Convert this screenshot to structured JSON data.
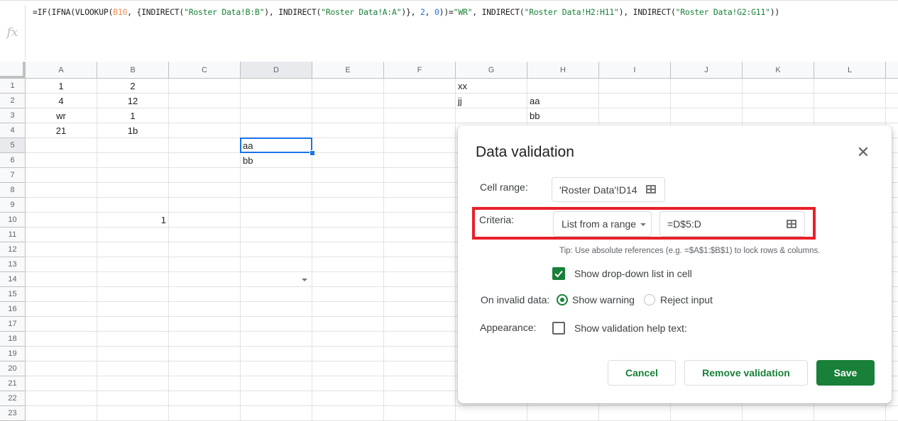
{
  "formula_bar": {
    "icon": "fx",
    "formula_parts": [
      {
        "t": "=IF(IFNA(VLOOKUP(",
        "k": "plain"
      },
      {
        "t": "B10",
        "k": "ref"
      },
      {
        "t": ", {INDIRECT(",
        "k": "plain"
      },
      {
        "t": "\"Roster Data!B:B\"",
        "k": "str"
      },
      {
        "t": "), INDIRECT(",
        "k": "plain"
      },
      {
        "t": "\"Roster Data!A:A\"",
        "k": "str"
      },
      {
        "t": ")}, ",
        "k": "plain"
      },
      {
        "t": "2",
        "k": "num"
      },
      {
        "t": ", ",
        "k": "plain"
      },
      {
        "t": "0",
        "k": "num"
      },
      {
        "t": "))=",
        "k": "plain"
      },
      {
        "t": "\"WR\"",
        "k": "str"
      },
      {
        "t": ", INDIRECT(",
        "k": "plain"
      },
      {
        "t": "\"Roster Data!H2:H11\"",
        "k": "str"
      },
      {
        "t": "), INDIRECT(",
        "k": "plain"
      },
      {
        "t": "\"Roster Data!G2:G11\"",
        "k": "str"
      },
      {
        "t": "))",
        "k": "plain"
      }
    ]
  },
  "sheet": {
    "columns": [
      "A",
      "B",
      "C",
      "D",
      "E",
      "F",
      "G",
      "H",
      "I",
      "J",
      "K",
      "L"
    ],
    "selected_column": "D",
    "rows": [
      "1",
      "2",
      "3",
      "4",
      "5",
      "6",
      "7",
      "8",
      "9",
      "10",
      "11",
      "12",
      "13",
      "14",
      "15",
      "16",
      "17",
      "18",
      "19",
      "20",
      "21",
      "22",
      "23"
    ],
    "selected_row": "5",
    "selected_cell": "D5",
    "dropdown_cell": "D14",
    "cells": [
      {
        "ref": "A1",
        "value": "1",
        "align": "c"
      },
      {
        "ref": "B1",
        "value": "2",
        "align": "c"
      },
      {
        "ref": "A2",
        "value": "4",
        "align": "c"
      },
      {
        "ref": "B2",
        "value": "12",
        "align": "c"
      },
      {
        "ref": "A3",
        "value": "wr",
        "align": "c"
      },
      {
        "ref": "B3",
        "value": "1",
        "align": "c"
      },
      {
        "ref": "A4",
        "value": "21",
        "align": "c"
      },
      {
        "ref": "B4",
        "value": "1b",
        "align": "c"
      },
      {
        "ref": "D5",
        "value": "aa",
        "align": "l"
      },
      {
        "ref": "D6",
        "value": "bb",
        "align": "l"
      },
      {
        "ref": "B10",
        "value": "1",
        "align": "r"
      },
      {
        "ref": "G1",
        "value": "xx",
        "align": "l"
      },
      {
        "ref": "G2",
        "value": "jj",
        "align": "l"
      },
      {
        "ref": "H2",
        "value": "aa",
        "align": "l"
      },
      {
        "ref": "H3",
        "value": "bb",
        "align": "l"
      }
    ]
  },
  "dialog": {
    "title": "Data validation",
    "close_icon": "close-icon",
    "cell_range_label": "Cell range:",
    "cell_range_value": "'Roster Data'!D14",
    "criteria_label": "Criteria:",
    "criteria_type": "List from a range",
    "criteria_value": "=D$5:D",
    "tip": "Tip: Use absolute references (e.g. =$A$1:$B$1) to lock rows & columns.",
    "show_dropdown_label": "Show drop-down list in cell",
    "show_dropdown_checked": true,
    "invalid_label": "On invalid data:",
    "invalid_options": [
      {
        "label": "Show warning",
        "selected": true
      },
      {
        "label": "Reject input",
        "selected": false
      }
    ],
    "appearance_label": "Appearance:",
    "help_text_label": "Show validation help text:",
    "help_text_checked": false,
    "buttons": {
      "cancel": "Cancel",
      "remove": "Remove validation",
      "save": "Save"
    },
    "accent_color": "#188038",
    "highlight_color": "#e8202a"
  }
}
